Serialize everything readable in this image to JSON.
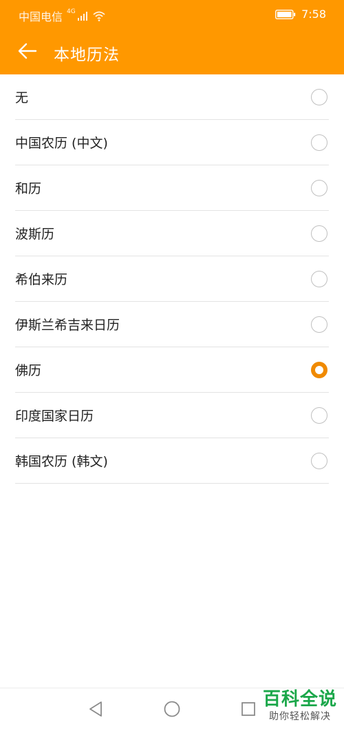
{
  "status_bar": {
    "carrier": "中国电信",
    "signal_tag": "4G",
    "time": "7:58"
  },
  "header": {
    "title": "本地历法"
  },
  "options": [
    {
      "label": "无",
      "selected": false
    },
    {
      "label": "中国农历 (中文)",
      "selected": false
    },
    {
      "label": "和历",
      "selected": false
    },
    {
      "label": "波斯历",
      "selected": false
    },
    {
      "label": "希伯来历",
      "selected": false
    },
    {
      "label": "伊斯兰希吉来日历",
      "selected": false
    },
    {
      "label": "佛历",
      "selected": true
    },
    {
      "label": "印度国家日历",
      "selected": false
    },
    {
      "label": "韩国农历 (韩文)",
      "selected": false
    }
  ],
  "watermark": {
    "title": "百科全说",
    "subtitle": "助你轻松解决"
  },
  "colors": {
    "accent": "#FF9800",
    "radio_selected": "#F08A00",
    "watermark_green": "#1BA74A"
  }
}
